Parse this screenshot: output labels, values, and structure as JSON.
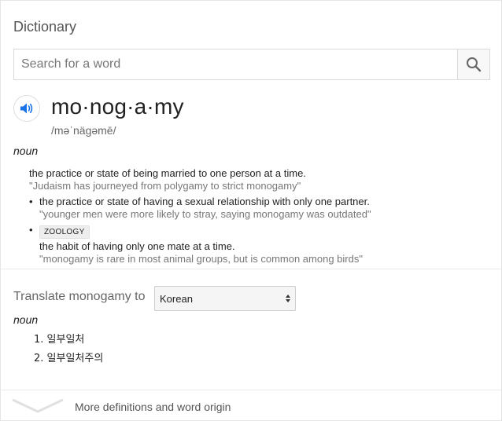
{
  "header": {
    "title": "Dictionary"
  },
  "search": {
    "placeholder": "Search for a word",
    "value": ""
  },
  "entry": {
    "word": "mo·nog·a·my",
    "phonetic": "/məˈnäɡəmē/",
    "part_of_speech": "noun",
    "senses": [
      {
        "definition": "the practice or state of being married to one person at a time.",
        "example": "\"Judaism has journeyed from polygamy to strict monogamy\""
      },
      {
        "definition": "the practice or state of having a sexual relationship with only one partner.",
        "example": "\"younger men were more likely to stray, saying monogamy was outdated\""
      },
      {
        "tag": "ZOOLOGY",
        "definition": "the habit of having only one mate at a time.",
        "example": "\"monogamy is rare in most animal groups, but is common among birds\""
      }
    ]
  },
  "translate": {
    "label": "Translate monogamy to",
    "selected_language": "Korean",
    "part_of_speech": "noun",
    "results": [
      "1.  일부일처",
      "2.  일부일처주의"
    ]
  },
  "footer": {
    "more_label": "More definitions and word origin"
  },
  "icons": {
    "search": "search-icon",
    "speaker": "speaker-icon",
    "expand": "chevron-down-icon"
  },
  "colors": {
    "accent": "#1a73e8",
    "muted": "#777777"
  }
}
